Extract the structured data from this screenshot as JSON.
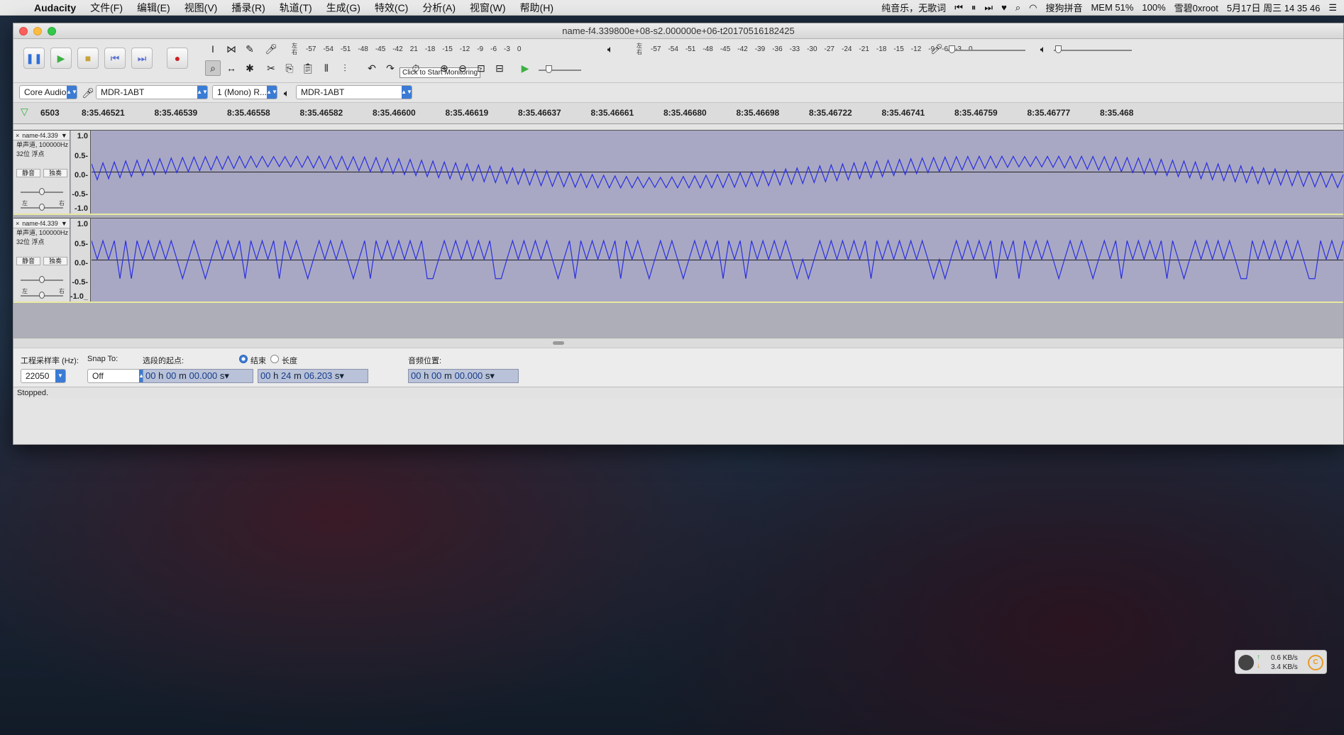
{
  "menubar": {
    "app_name": "Audacity",
    "items": [
      "文件(F)",
      "编辑(E)",
      "视图(V)",
      "播录(R)",
      "轨道(T)",
      "生成(G)",
      "特效(C)",
      "分析(A)",
      "视窗(W)",
      "帮助(H)"
    ],
    "now_playing": "纯音乐，无歌词",
    "input_method": "搜狗拼音",
    "mem": "MEM 51%",
    "battery": "100%",
    "user": "雪碧0xroot",
    "datetime": "5月17日 周三  14 35 46"
  },
  "window": {
    "title": "name-f4.339800e+08-s2.000000e+06-t20170516182425"
  },
  "toolbar": {
    "tooltip": "Click to Start Monitoring",
    "rec_meter_ticks": [
      "-57",
      "-54",
      "-51",
      "-48",
      "-45",
      "-42",
      "21",
      "-18",
      "-15",
      "-12",
      "-9",
      "-6",
      "-3",
      "0"
    ],
    "play_meter_ticks": [
      "-57",
      "-54",
      "-51",
      "-48",
      "-45",
      "-42",
      "-39",
      "-36",
      "-33",
      "-30",
      "-27",
      "-24",
      "-21",
      "-18",
      "-15",
      "-12",
      "-9",
      "-6",
      "-3",
      "0"
    ],
    "lr_label_left": "左",
    "lr_label_right": "右"
  },
  "devices": {
    "host": "Core Audio",
    "input": "MDR-1ABT",
    "channels": "1 (Mono) R...",
    "output": "MDR-1ABT"
  },
  "ruler": {
    "labels": [
      "6503",
      "8:35.46521",
      "8:35.46539",
      "8:35.46558",
      "8:35.46582",
      "8:35.46600",
      "8:35.46619",
      "8:35.46637",
      "8:35.46661",
      "8:35.46680",
      "8:35.46698",
      "8:35.46722",
      "8:35.46741",
      "8:35.46759",
      "8:35.46777",
      "8:35.468"
    ]
  },
  "tracks": [
    {
      "name": "name-f4.339",
      "info1": "单声道, 100000Hz",
      "info2": "32位 浮点",
      "mute": "静音",
      "solo": "独奏",
      "pan_left": "左",
      "pan_right": "右",
      "scale": [
        "1.0",
        "0.5-",
        "0.0-",
        "-0.5-",
        "-1.0"
      ]
    },
    {
      "name": "name-f4.339",
      "info1": "单声道, 100000Hz",
      "info2": "32位 浮点",
      "mute": "静音",
      "solo": "独奏",
      "pan_left": "左",
      "pan_right": "右",
      "scale": [
        "1.0",
        "0.5-",
        "0.0-",
        "-0.5-",
        "-1.0_"
      ]
    }
  ],
  "selection": {
    "rate_label": "工程采样率 (Hz):",
    "rate_value": "22050",
    "snap_label": "Snap To:",
    "snap_value": "Off",
    "start_label": "选段的起点:",
    "end_label": "结束",
    "length_label": "长度",
    "pos_label": "音频位置:",
    "start_tc": {
      "h": "00",
      "m": "00",
      "s": "00.000"
    },
    "end_tc": {
      "h": "00",
      "m": "24",
      "s": "06.203"
    },
    "pos_tc": {
      "h": "00",
      "m": "00",
      "s": "00.000"
    },
    "unit_h": "h",
    "unit_m": "m",
    "unit_s": "s"
  },
  "status": "Stopped.",
  "netspeed": {
    "up": "0.6 KB/s",
    "down": "3.4 KB/s"
  },
  "colors": {
    "waveform": "#2a2ee0",
    "track_bg": "#a8a8c4",
    "accent": "#3a7bd5"
  }
}
